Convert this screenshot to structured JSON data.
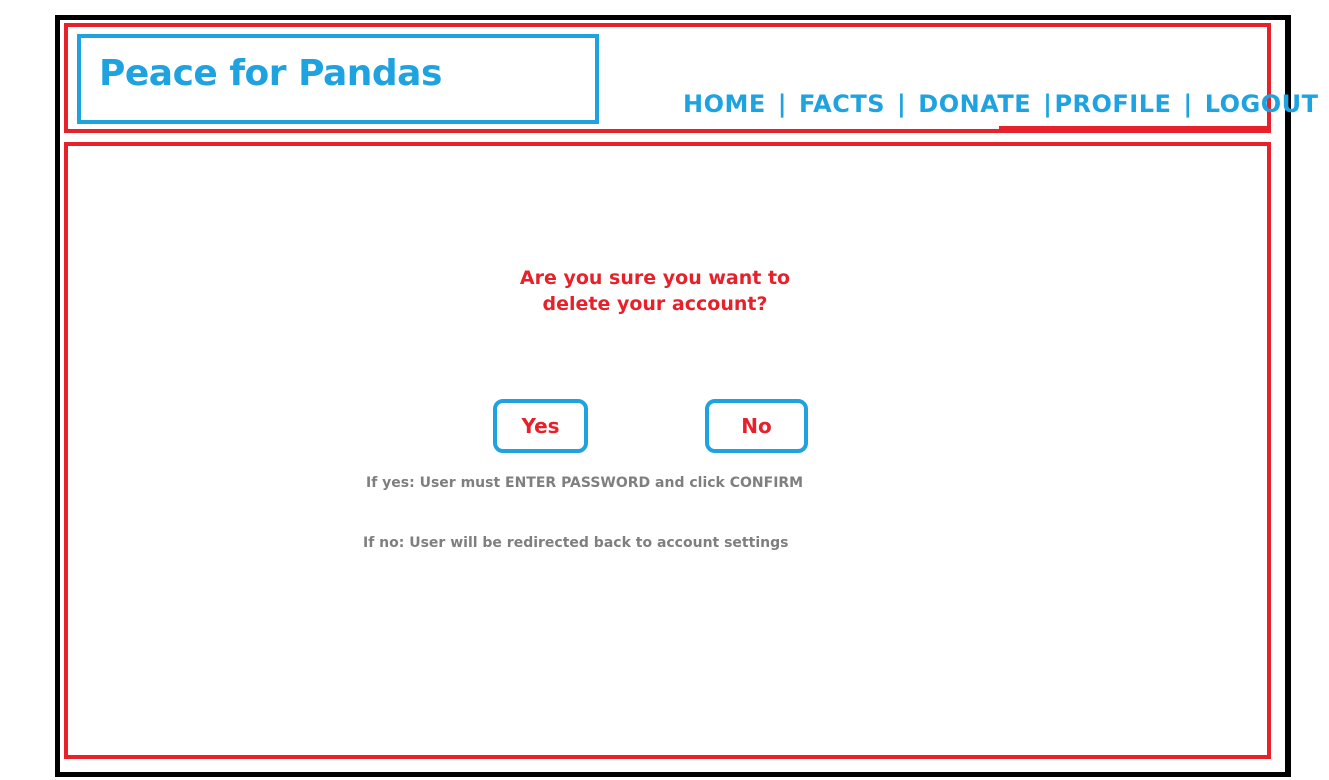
{
  "header": {
    "title": "Peace for Pandas"
  },
  "nav": {
    "items": [
      {
        "label": "HOME"
      },
      {
        "label": "FACTS"
      },
      {
        "label": "DONATE"
      },
      {
        "label": "PROFILE"
      },
      {
        "label": "LOGOUT"
      }
    ],
    "separator": "|"
  },
  "dialog": {
    "question_line1": "Are you sure you want to",
    "question_line2": "delete your account?",
    "yes_label": "Yes",
    "no_label": "No"
  },
  "notes": {
    "if_yes": "If yes: User must ENTER PASSWORD and click CONFIRM",
    "if_no": "If no: User will be redirected back to account settings"
  },
  "colors": {
    "accent_blue": "#1fa3e0",
    "accent_red": "#e8202a",
    "note_gray": "#7f7f7f",
    "frame": "#000000"
  }
}
